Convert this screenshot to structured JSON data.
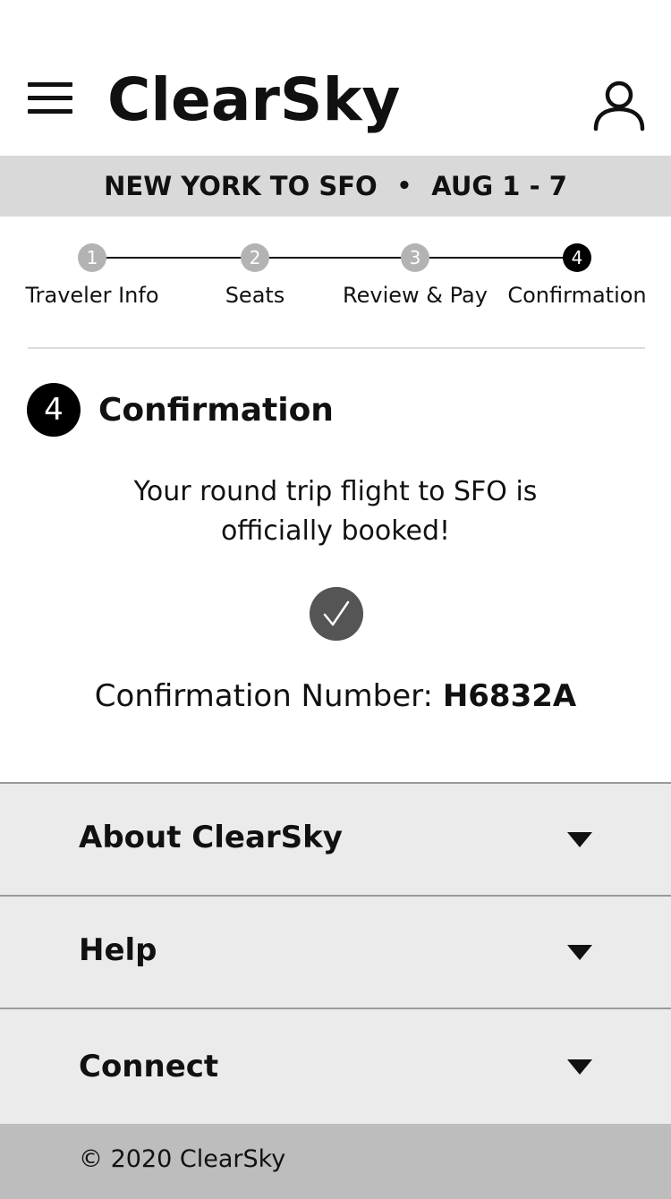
{
  "header": {
    "brand": "ClearSky",
    "menu_icon": "hamburger-menu-icon",
    "profile_icon": "user-profile-icon"
  },
  "trip": {
    "route": "NEW YORK TO SFO",
    "separator": "•",
    "dates": "AUG 1 - 7"
  },
  "stepper": {
    "steps": [
      {
        "number": "1",
        "label": "Traveler Info",
        "state": "done"
      },
      {
        "number": "2",
        "label": "Seats",
        "state": "done"
      },
      {
        "number": "3",
        "label": "Review & Pay",
        "state": "done"
      },
      {
        "number": "4",
        "label": "Confirmation",
        "state": "active"
      }
    ]
  },
  "confirmation": {
    "step_number": "4",
    "title": "Confirmation",
    "message_line1": "Your round trip flight to SFO is",
    "message_line2": "officially booked!",
    "check_icon": "checkmark-icon",
    "number_label": "Confirmation Number:",
    "number_value": "H6832A"
  },
  "accordion": {
    "items": [
      {
        "label": "About ClearSky"
      },
      {
        "label": "Help"
      },
      {
        "label": "Connect"
      }
    ]
  },
  "footer": {
    "copyright": "© 2020 ClearSky"
  },
  "colors": {
    "trip_bar": "#d9d9d9",
    "step_done": "#b3b3b3",
    "step_active": "#000000",
    "check": "#555555",
    "accordion_bg": "#ebebeb",
    "footer_bg": "#bdbdbd"
  }
}
